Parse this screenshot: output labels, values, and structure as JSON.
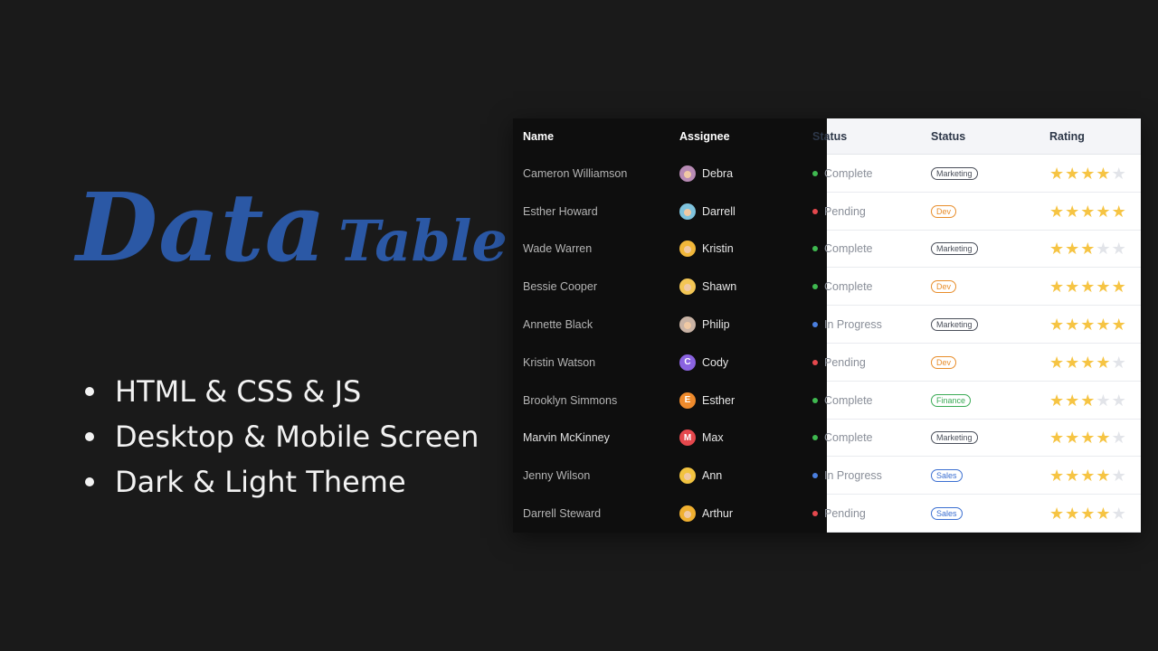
{
  "promo": {
    "title_big": "Data",
    "title_small": "Table",
    "features": [
      "HTML & CSS & JS",
      "Desktop & Mobile Screen",
      "Dark & Light Theme"
    ]
  },
  "colors": {
    "title": "#2b58a5",
    "star_on": "#f6c443",
    "star_off": "#e2e4e9",
    "status_complete": "#3fb950",
    "status_pending": "#e5484d",
    "status_in_progress": "#4a7fe0",
    "badge_marketing": "#4a4f5a",
    "badge_dev": "#e88d2a",
    "badge_finance": "#3aaa55",
    "badge_sales": "#3b6fd1"
  },
  "table": {
    "headers": {
      "name": "Name",
      "assignee": "Assignee",
      "status": "Status",
      "dept": "Status",
      "rating": "Rating"
    },
    "rows": [
      {
        "name": "Cameron Williamson",
        "assignee": "Debra",
        "avatar": "photo",
        "avatar_color": "#b88bb5",
        "status": "Complete",
        "status_key": "complete",
        "badge": "Marketing",
        "badge_key": "marketing",
        "rating": 4
      },
      {
        "name": "Esther Howard",
        "assignee": "Darrell",
        "avatar": "photo",
        "avatar_color": "#7fc3dd",
        "status": "Pending",
        "status_key": "pending",
        "badge": "Dev",
        "badge_key": "dev",
        "rating": 5
      },
      {
        "name": "Wade Warren",
        "assignee": "Kristin",
        "avatar": "photo",
        "avatar_color": "#f1b73a",
        "status": "Complete",
        "status_key": "complete",
        "badge": "Marketing",
        "badge_key": "marketing",
        "rating": 3
      },
      {
        "name": "Bessie Cooper",
        "assignee": "Shawn",
        "avatar": "photo",
        "avatar_color": "#f3c655",
        "status": "Complete",
        "status_key": "complete",
        "badge": "Dev",
        "badge_key": "dev",
        "rating": 5
      },
      {
        "name": "Annette Black",
        "assignee": "Philip",
        "avatar": "photo",
        "avatar_color": "#c9b3a5",
        "status": "In Progress",
        "status_key": "in_progress",
        "badge": "Marketing",
        "badge_key": "marketing",
        "rating": 5
      },
      {
        "name": "Kristin Watson",
        "assignee": "Cody",
        "avatar": "letter",
        "avatar_letter": "C",
        "avatar_color": "#8a63e0",
        "status": "Pending",
        "status_key": "pending",
        "badge": "Dev",
        "badge_key": "dev",
        "rating": 4
      },
      {
        "name": "Brooklyn Simmons",
        "assignee": "Esther",
        "avatar": "letter",
        "avatar_letter": "E",
        "avatar_color": "#ee8a2c",
        "status": "Complete",
        "status_key": "complete",
        "badge": "Finance",
        "badge_key": "finance",
        "rating": 3
      },
      {
        "name": "Marvin McKinney",
        "assignee": "Max",
        "avatar": "letter",
        "avatar_letter": "M",
        "avatar_color": "#e5484d",
        "status": "Complete",
        "status_key": "complete",
        "badge": "Marketing",
        "badge_key": "marketing",
        "rating": 4,
        "highlight": true
      },
      {
        "name": "Jenny Wilson",
        "assignee": "Ann",
        "avatar": "photo",
        "avatar_color": "#f2c340",
        "status": "In Progress",
        "status_key": "in_progress",
        "badge": "Sales",
        "badge_key": "sales",
        "rating": 4
      },
      {
        "name": "Darrell Steward",
        "assignee": "Arthur",
        "avatar": "photo",
        "avatar_color": "#f0b030",
        "status": "Pending",
        "status_key": "pending",
        "badge": "Sales",
        "badge_key": "sales",
        "rating": 4
      }
    ]
  }
}
